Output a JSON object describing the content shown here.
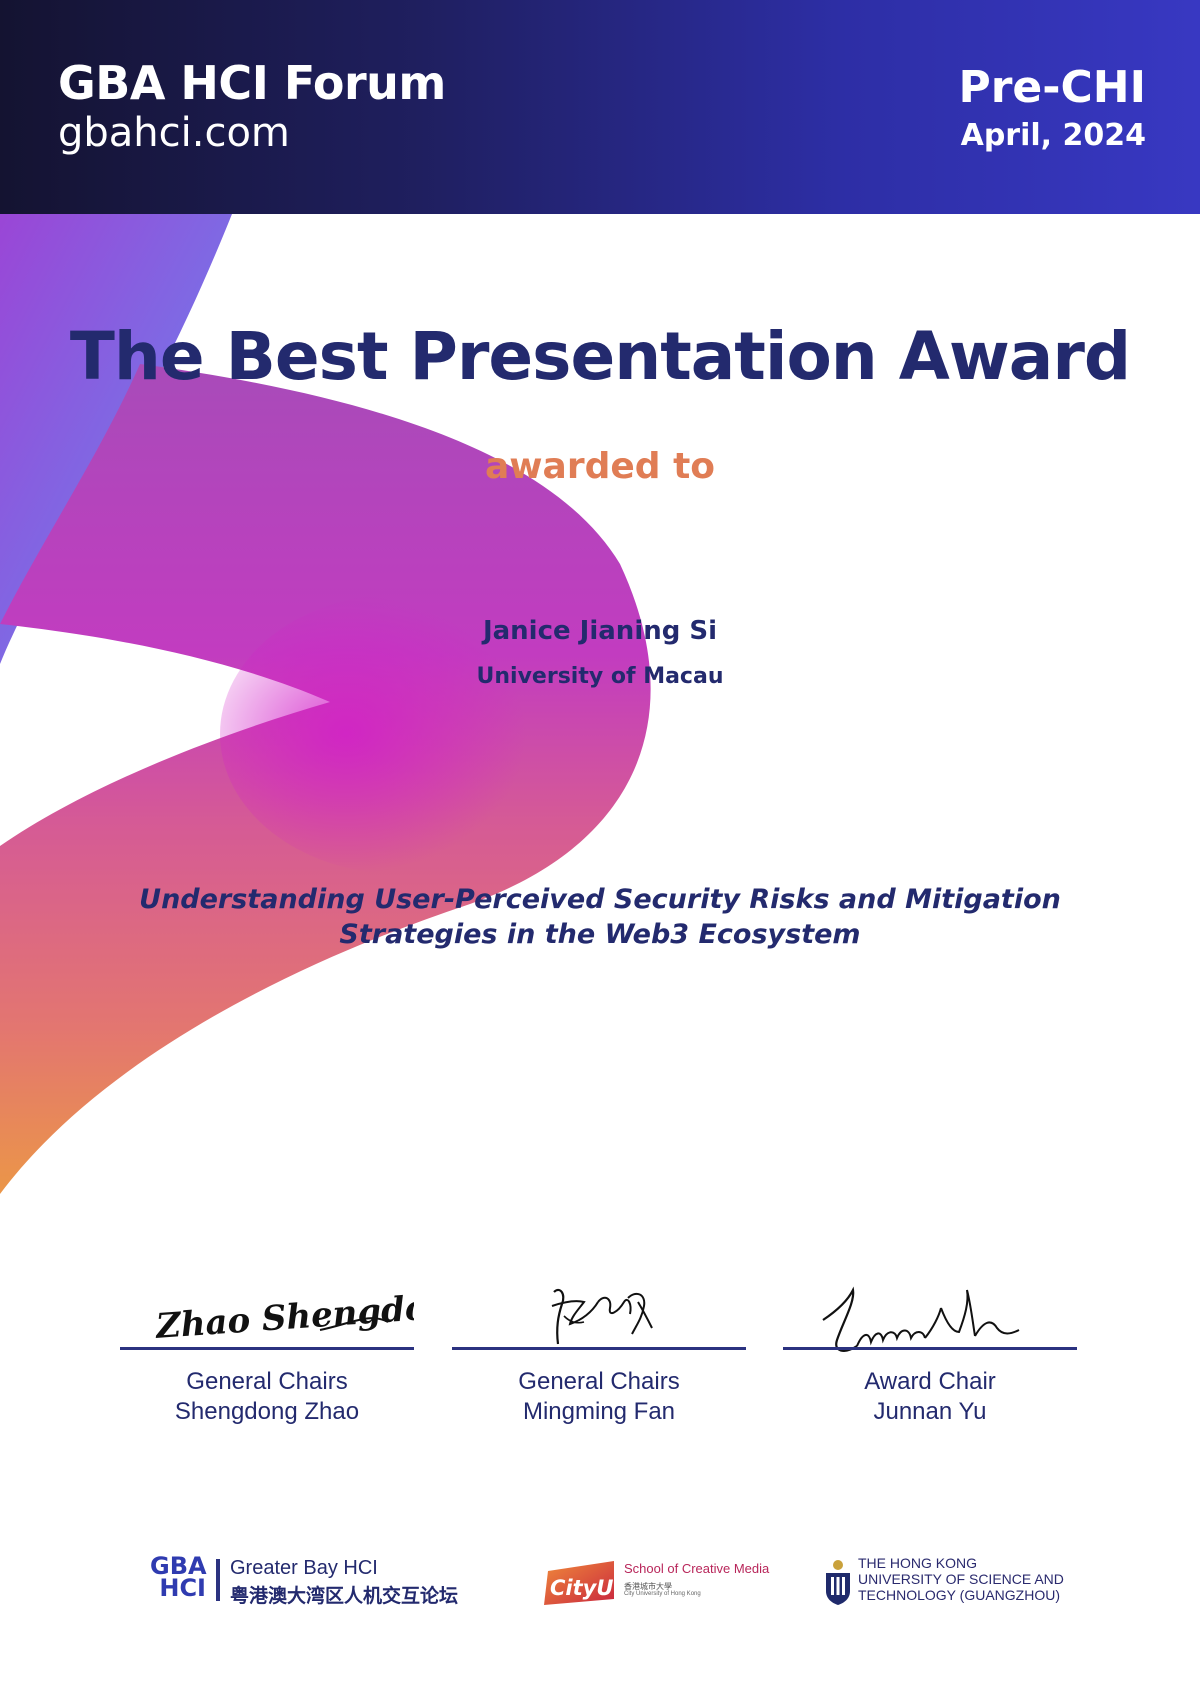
{
  "header": {
    "brand_title": "GBA HCI Forum",
    "brand_url": "gbahci.com",
    "event_name": "Pre-CHI",
    "event_date": "April, 2024"
  },
  "certificate": {
    "award_title": "The Best Presentation Award",
    "awarded_to_label": "awarded to",
    "recipient_name": "Janice Jianing Si",
    "recipient_affiliation": "University of Macau",
    "paper_title_line1": "Understanding User-Perceived Security Risks and Mitigation",
    "paper_title_line2": "Strategies in the Web3 Ecosystem"
  },
  "signatories": [
    {
      "role": "General Chairs",
      "name": "Shengdong Zhao",
      "signature_text": "Zhao Shengdong"
    },
    {
      "role": "General Chairs",
      "name": "Mingming Fan"
    },
    {
      "role": "Award Chair",
      "name": "Junnan Yu"
    }
  ],
  "logos": {
    "gba_mark_line1": "GBA",
    "gba_mark_line2": "HCI",
    "gba_name_en": "Greater Bay HCI",
    "gba_name_cn": "粤港澳大湾区人机交互论坛",
    "cityu_badge": "CityU",
    "cityu_school": "School of Creative Media",
    "cityu_name_cn": "香港城市大學",
    "cityu_name_en": "City University of Hong Kong",
    "hkust_line1": "THE HONG KONG",
    "hkust_line2": "UNIVERSITY OF SCIENCE AND",
    "hkust_line3": "TECHNOLOGY (GUANGZHOU)"
  },
  "colors": {
    "header_dark": "#141331",
    "header_accent": "#3838c2",
    "title_navy": "#232a6e",
    "awarded_orange": "#e07d55",
    "ribbon_magenta": "#c02fc0",
    "ribbon_orange": "#e8883e",
    "ribbon_blue": "#6a7be0"
  }
}
